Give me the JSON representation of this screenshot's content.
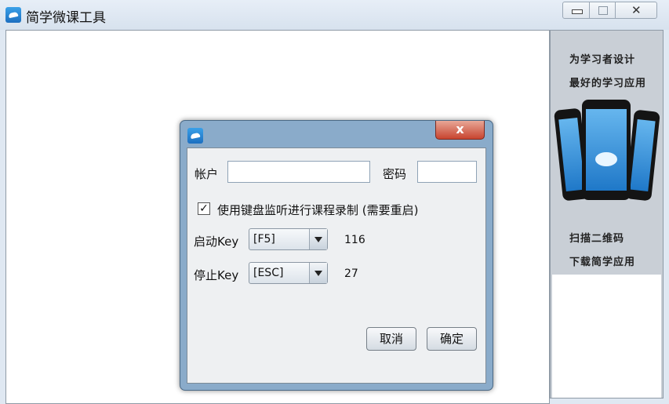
{
  "window": {
    "title": "简学微课工具"
  },
  "sidebar": {
    "slogan_line1": "为学习者设计",
    "slogan_line2": "最好的学习应用",
    "scan_line1": "扫描二维码",
    "scan_line2": "下载简学应用"
  },
  "dialog": {
    "close_label": "x",
    "account_label": "帐户",
    "account_value": "",
    "password_label": "密码",
    "password_value": "",
    "keyboard_monitor": {
      "checked": true,
      "label": "使用键盘监听进行课程录制 (需要重启)"
    },
    "start_key": {
      "label": "启动Key",
      "selected": "[F5]",
      "code": "116"
    },
    "stop_key": {
      "label": "停止Key",
      "selected": "[ESC]",
      "code": "27"
    },
    "cancel_label": "取消",
    "confirm_label": "确定"
  }
}
